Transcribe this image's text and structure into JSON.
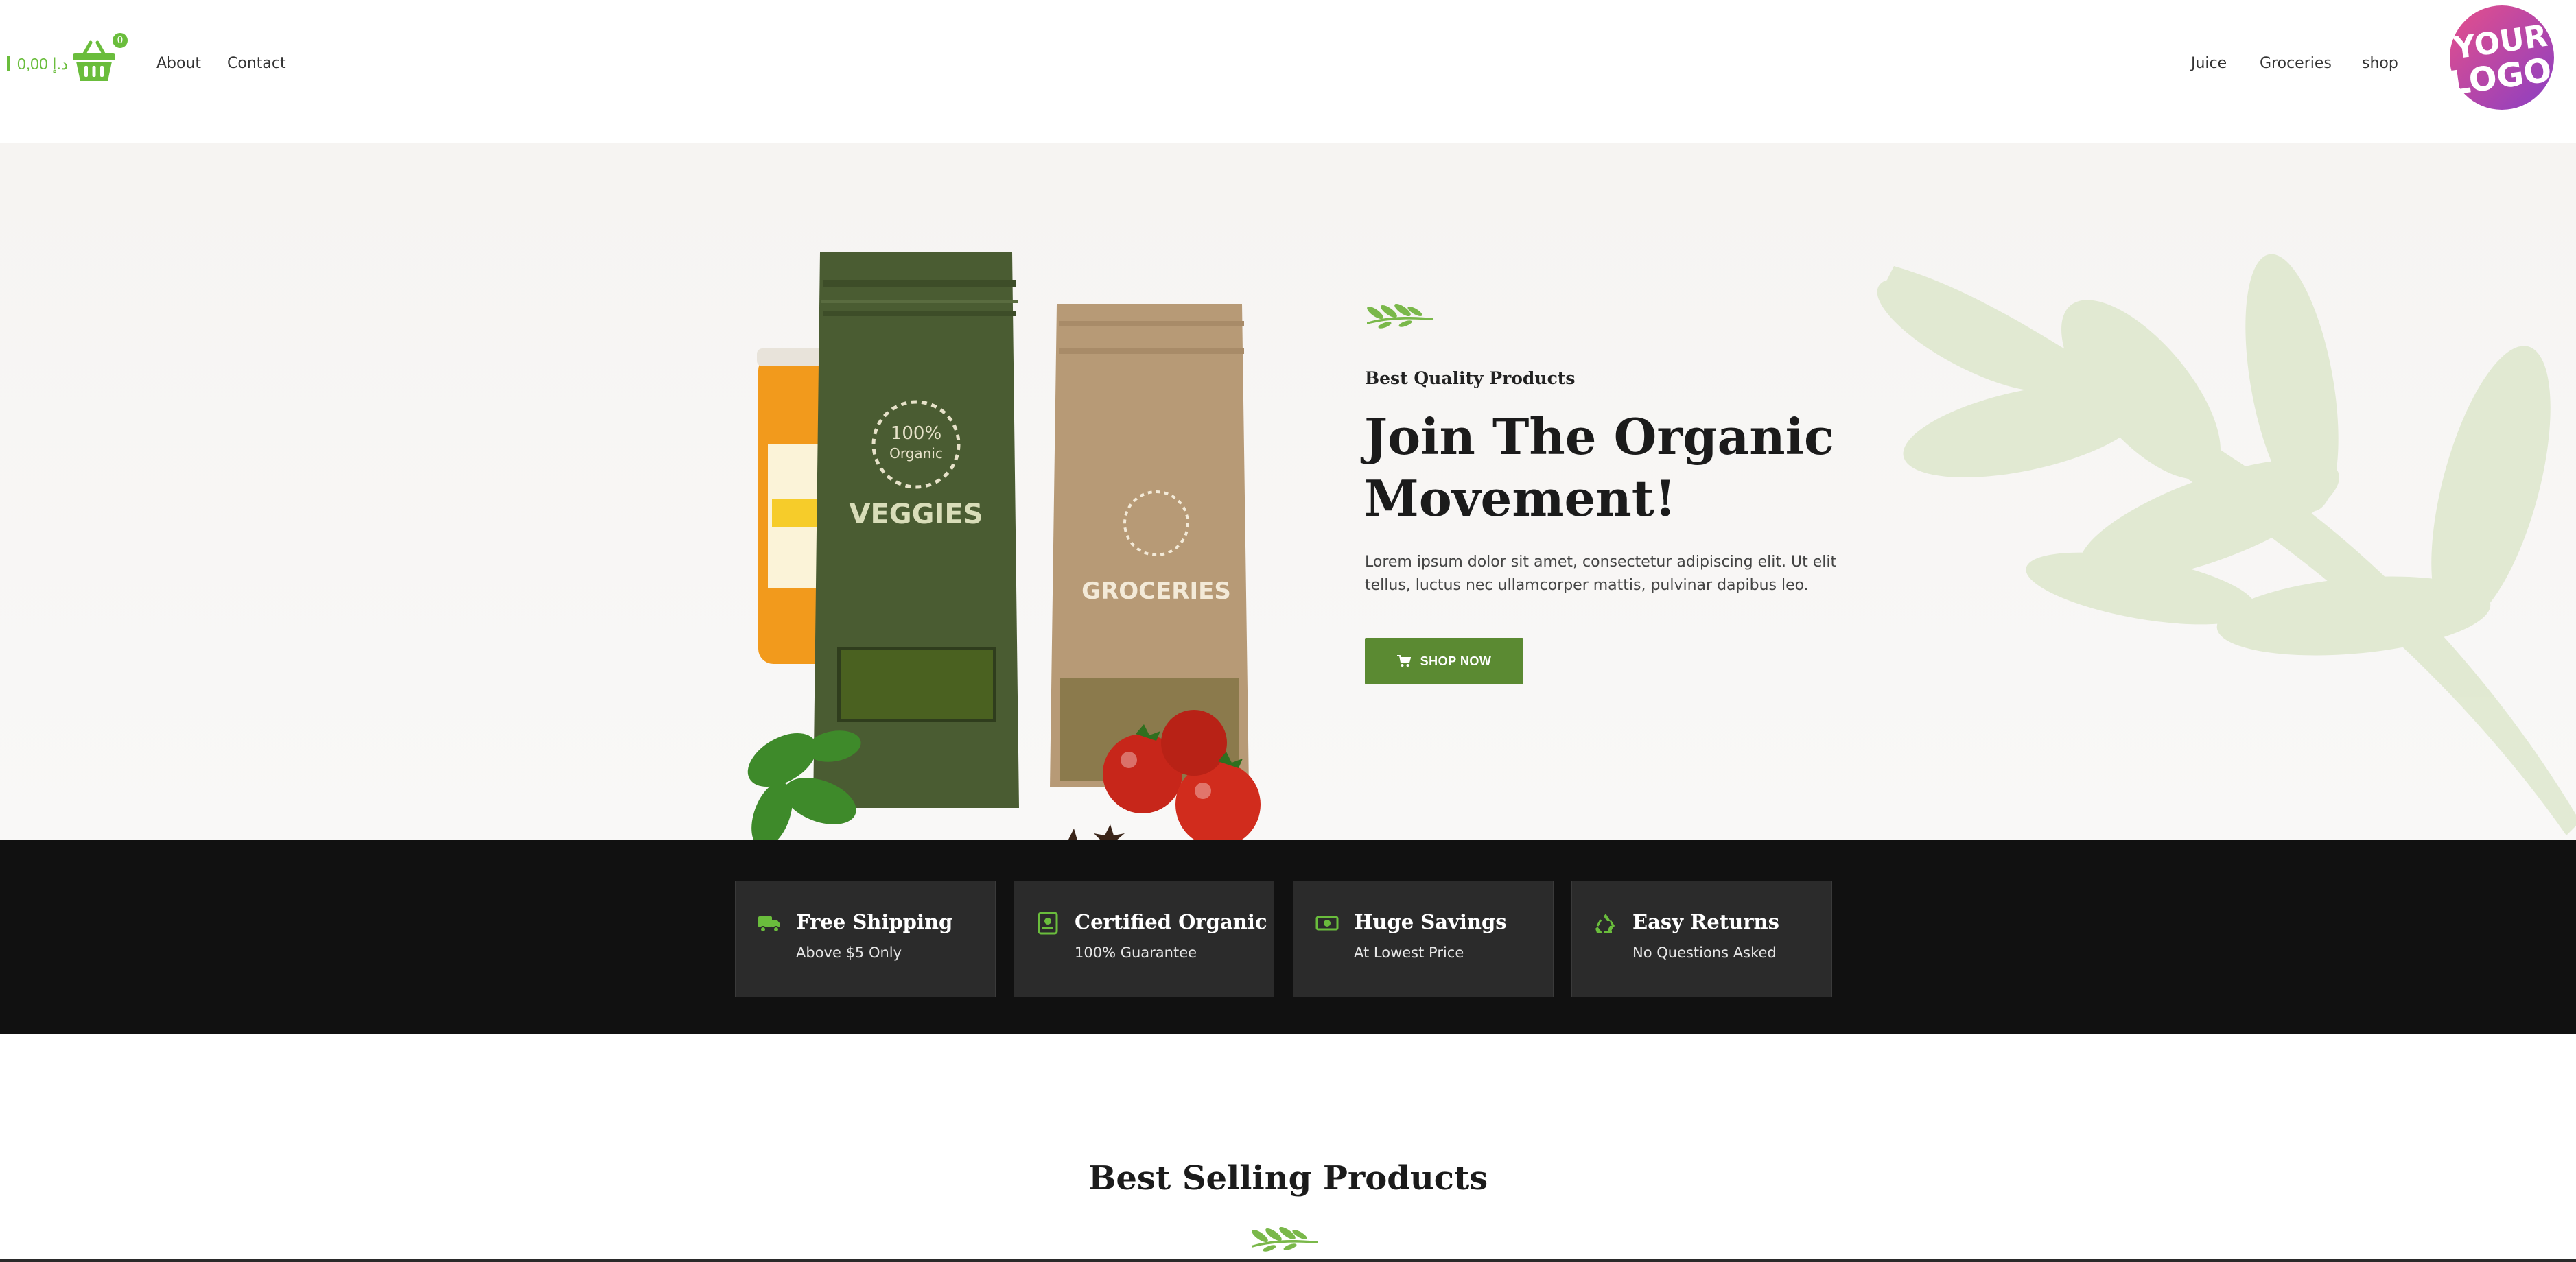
{
  "header": {
    "cart_amount": "0,00 د.إ",
    "cart_count": "0",
    "nav_left": [
      "About",
      "Contact"
    ],
    "nav_right": [
      "Juice",
      "Groceries",
      "shop"
    ],
    "logo_text": [
      "YOUR",
      "LOGO"
    ]
  },
  "hero": {
    "eyebrow": "Best Quality Products",
    "title": "Join The Organic Movement!",
    "description": "Lorem ipsum dolor sit amet, consectetur adipiscing elit. Ut elit tellus, luctus nec ullamcorper mattis, pulvinar dapibus leo.",
    "button_label": "SHOP NOW",
    "product_labels": {
      "veggies": "VEGGIES",
      "groceries": "GROCERIES",
      "organic_top": "100%",
      "organic_bottom": "Organic"
    }
  },
  "features": [
    {
      "title": "Free Shipping",
      "subtitle": "Above $5 Only",
      "icon": "truck-icon"
    },
    {
      "title": "Certified Organic",
      "subtitle": "100% Guarantee",
      "icon": "certificate-icon"
    },
    {
      "title": "Huge Savings",
      "subtitle": "At Lowest Price",
      "icon": "money-icon"
    },
    {
      "title": "Easy Returns",
      "subtitle": "No Questions Asked",
      "icon": "recycle-icon"
    }
  ],
  "best_selling": {
    "title": "Best Selling Products"
  },
  "colors": {
    "accent": "#6abd3c",
    "button": "#5b8a32",
    "band_bg": "#111111",
    "feature_bg": "#2b2b2b"
  }
}
